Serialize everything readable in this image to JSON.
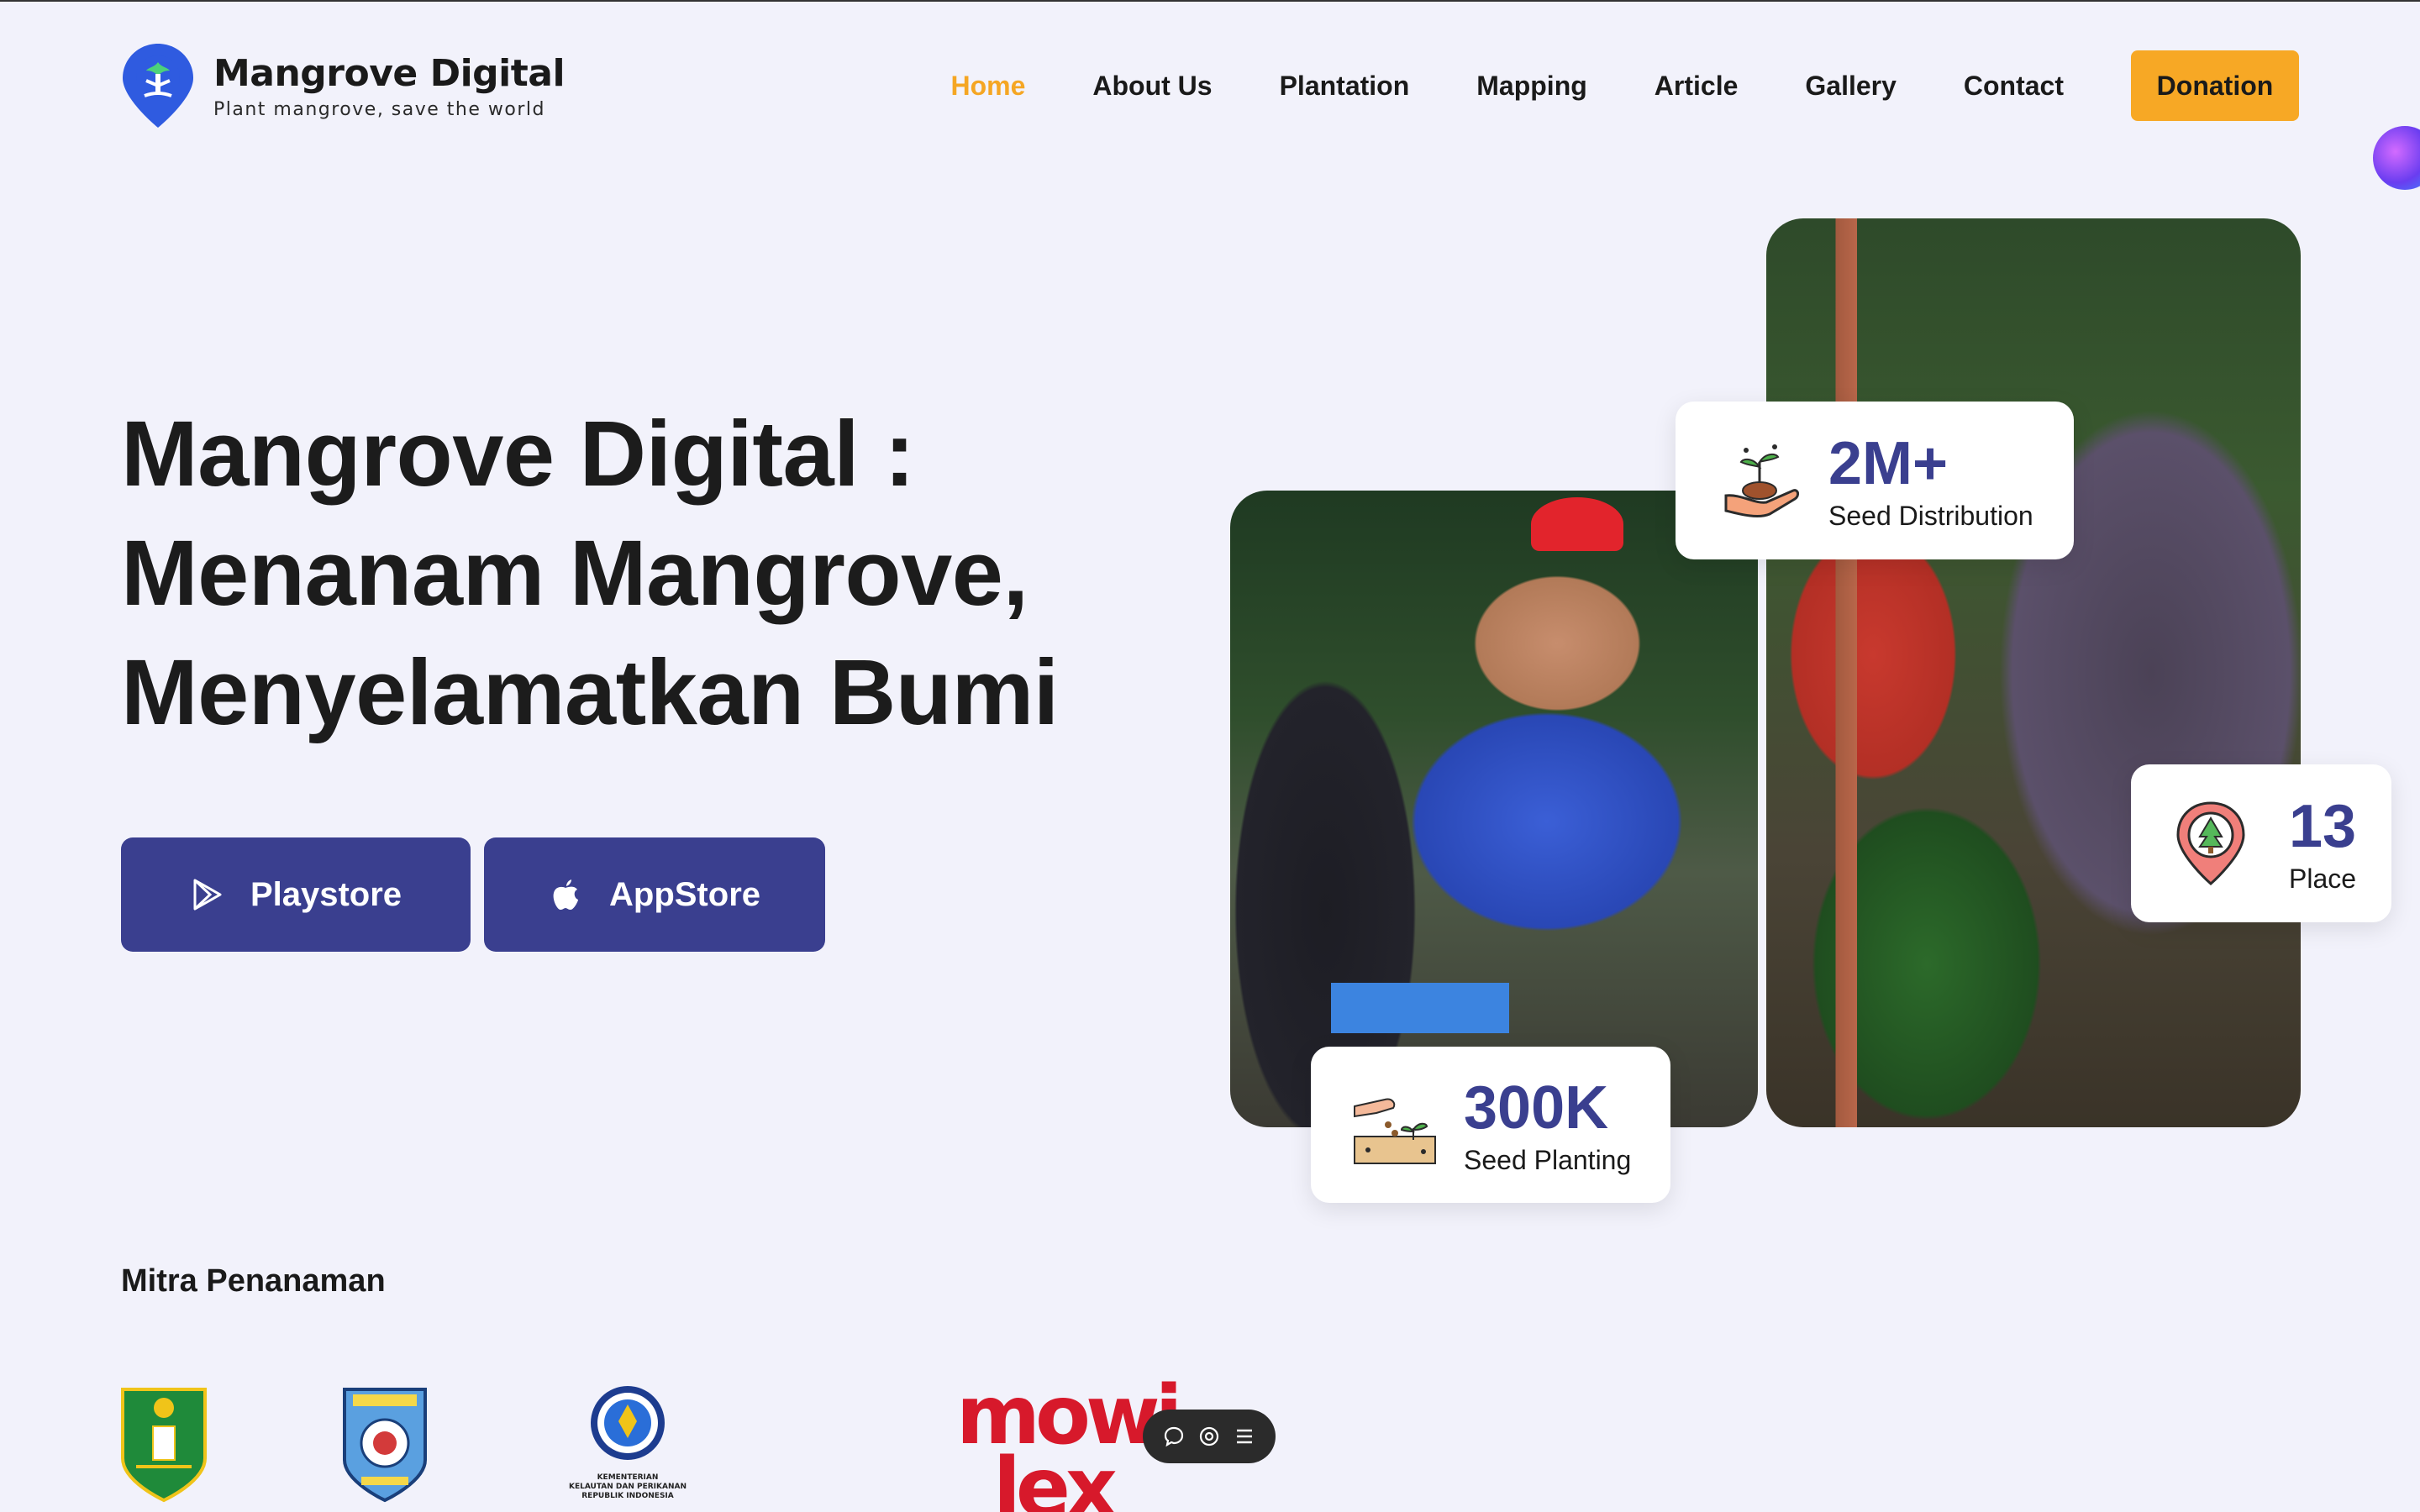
{
  "brand": {
    "title": "Mangrove Digital",
    "tagline": "Plant mangrove, save the world"
  },
  "nav": {
    "items": [
      "Home",
      "About Us",
      "Plantation",
      "Mapping",
      "Article",
      "Gallery",
      "Contact"
    ],
    "active": "Home",
    "donation_label": "Donation"
  },
  "hero": {
    "title_line1": "Mangrove Digital :",
    "title_line2": "Menanam Mangrove,",
    "title_line3": "Menyelamatkan Bumi",
    "playstore_label": "Playstore",
    "appstore_label": "AppStore"
  },
  "stats": {
    "seed_distribution": {
      "value": "2M+",
      "label": "Seed Distribution",
      "icon": "plant-in-hand-icon"
    },
    "place": {
      "value": "13",
      "label": "Place",
      "icon": "tree-location-pin-icon"
    },
    "seed_planting": {
      "value": "300K",
      "label": "Seed Planting",
      "icon": "seed-planting-icon"
    }
  },
  "partners": {
    "title": "Mitra Penanaman",
    "kkp_text_line1": "KEMENTERIAN",
    "kkp_text_line2": "KELAUTAN DAN PERIKANAN",
    "kkp_text_line3": "REPUBLIK INDONESIA",
    "mowilex_line1": "mowi",
    "mowilex_line2": "lex"
  },
  "colors": {
    "accent": "#f7a825",
    "primary": "#3a3f8f",
    "background": "#f2f2fb",
    "brand_pin": "#2f5be0"
  }
}
